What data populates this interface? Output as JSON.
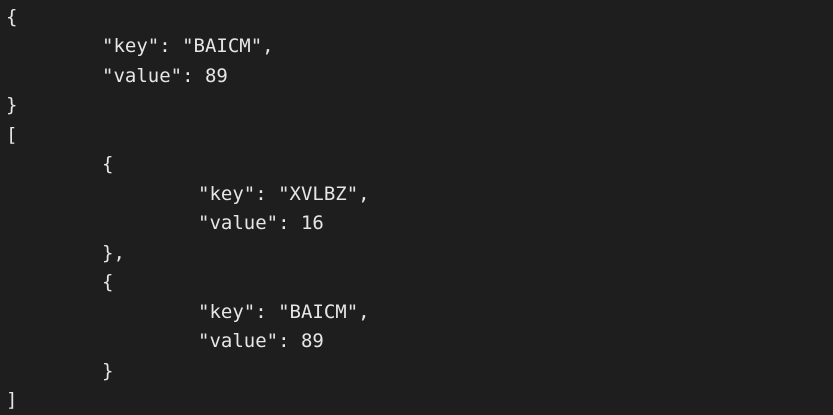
{
  "code_view": {
    "lines": [
      "{",
      "\"key\": \"BAICM\",",
      "\"value\": 89",
      "}",
      "[",
      "{",
      "\"key\": \"XVLBZ\",",
      "\"value\": 16",
      "},",
      "{",
      "\"key\": \"BAICM\",",
      "\"value\": 89",
      "}",
      "]"
    ]
  }
}
